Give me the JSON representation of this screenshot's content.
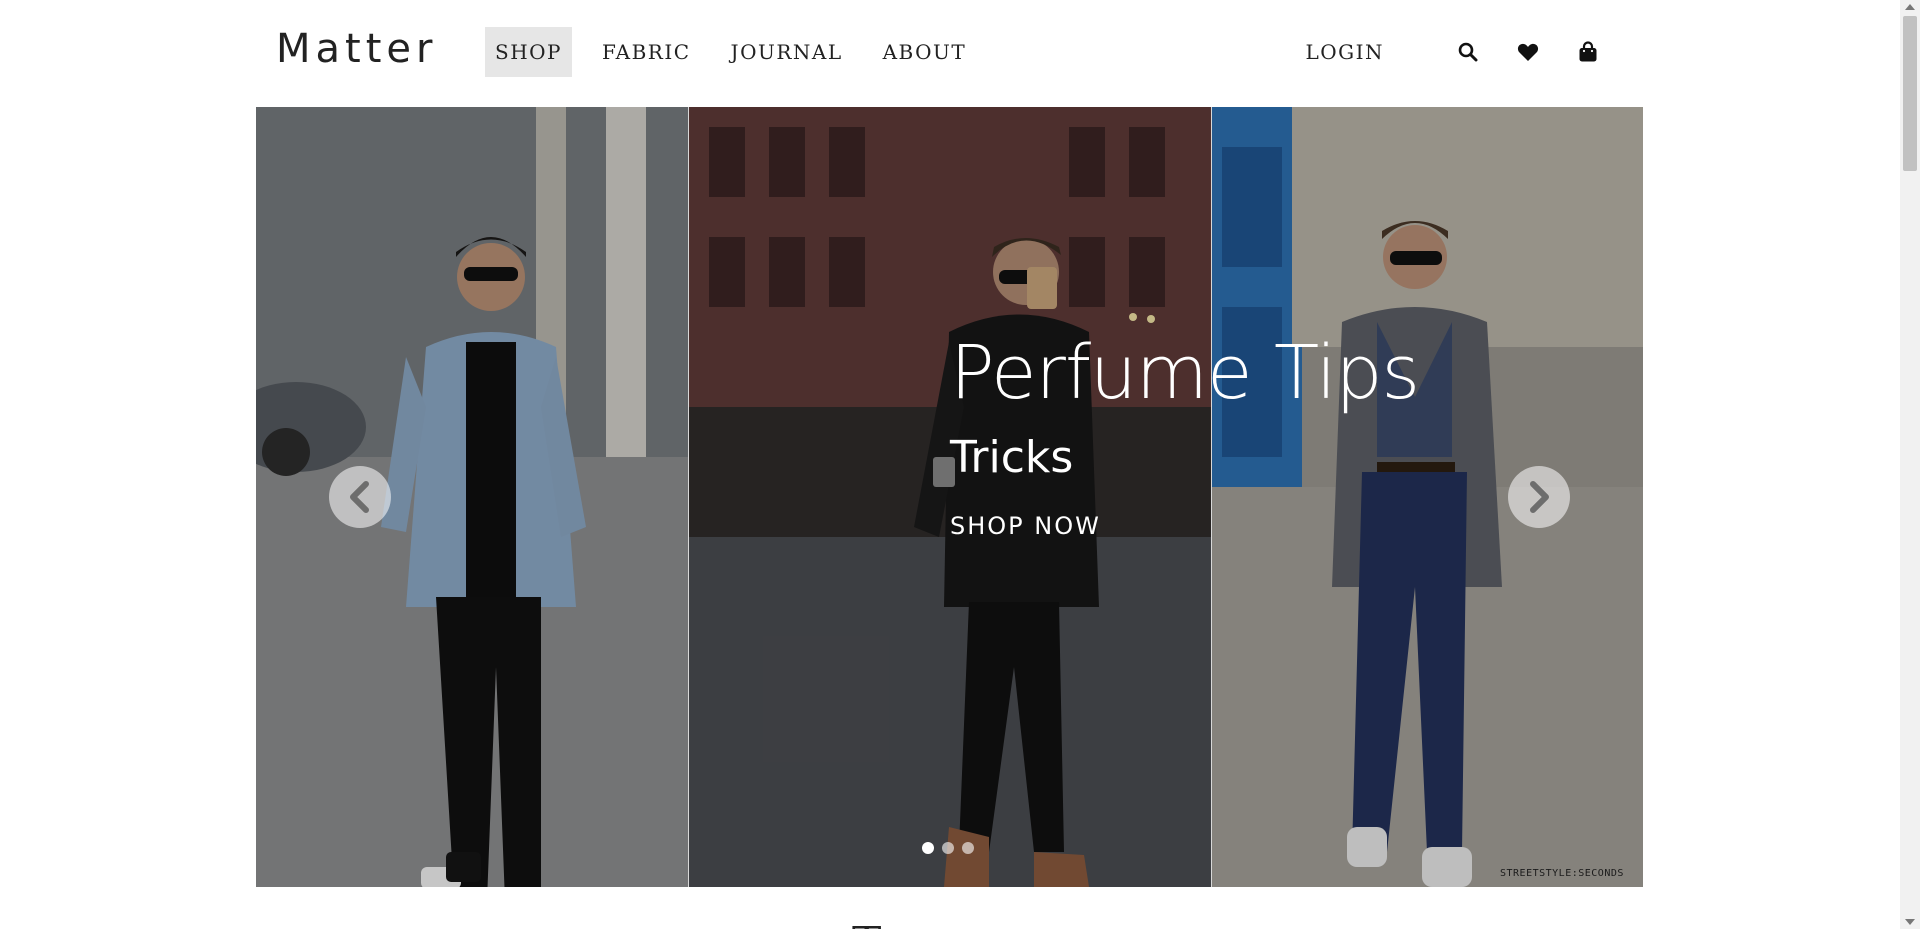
{
  "brand": {
    "logo_text": "Matter"
  },
  "nav": {
    "items": [
      {
        "label": "SHOP",
        "active": true
      },
      {
        "label": "FABRIC",
        "active": false
      },
      {
        "label": "JOURNAL",
        "active": false
      },
      {
        "label": "ABOUT",
        "active": false
      }
    ],
    "login_label": "LOGIN",
    "icons": [
      "search-icon",
      "heart-icon",
      "shopping-bag-icon"
    ]
  },
  "hero": {
    "title": "Perfume Tips",
    "subtitle": "Tricks",
    "cta_label": "SHOP NOW",
    "slides_total": 3,
    "active_slide": 1,
    "watermark_text": "STREETSTYLE:SECONDS"
  },
  "next_section": {
    "heading_peek": "T"
  },
  "colors": {
    "text": "#222222",
    "nav_active_bg": "#e6e6e6",
    "hero_text": "#ffffff"
  }
}
